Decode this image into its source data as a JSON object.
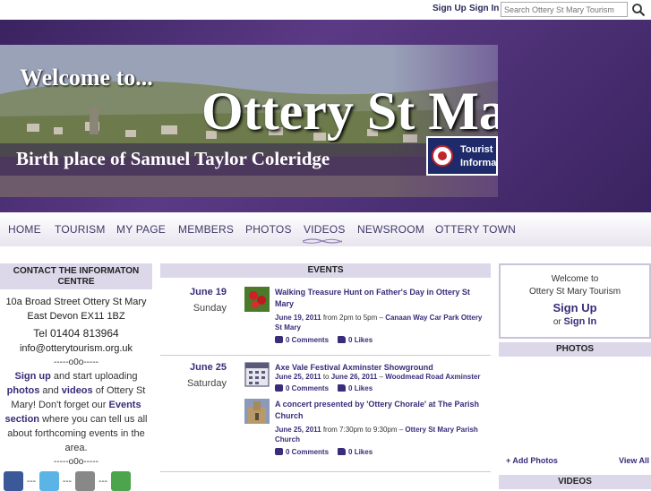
{
  "topbar": {
    "sign_up": "Sign Up",
    "sign_in": "Sign In",
    "search_placeholder": "Search Ottery St Mary Tourism"
  },
  "banner": {
    "welcome": "Welcome to...",
    "town": "Ottery St Ma",
    "birthplace": "Birth place of Samuel Taylor Coleridge",
    "tic_line1": "Tourist",
    "tic_line2": "Informa"
  },
  "nav": {
    "items": [
      "HOME",
      "TOURISM",
      "MY PAGE",
      "MEMBERS",
      "PHOTOS",
      "VIDEOS",
      "NEWSROOM",
      "OTTERY TOWN"
    ]
  },
  "contact": {
    "header": "CONTACT THE INFORMATON CENTRE",
    "address1": "10a Broad Street Ottery St Mary",
    "address2": "East Devon EX11 1BZ",
    "tel": "Tel 01404 813964",
    "email": "info@otterytourism.org.uk",
    "sep": "-----o0o-----",
    "promo_signup": "Sign up",
    "promo_text1": " and start uploading ",
    "promo_photos": "photos",
    "promo_and": " and ",
    "promo_videos": "videos",
    "promo_text2": " of Ottery St Mary! Don't forget our ",
    "promo_events": "Events section",
    "promo_text3": " where you can tell us all about forthcoming events in the area.",
    "sep2": "-----o0o-----",
    "social_dash": "---"
  },
  "events": {
    "header": "EVENTS",
    "days": [
      {
        "date": "June 19",
        "dow": "Sunday",
        "items": [
          {
            "title": "Walking Treasure Hunt on Father's Day in Ottery St Mary",
            "when_date": "June 19, 2011",
            "when_rest": " from 2pm to 5pm – ",
            "where": "Canaan Way Car Park Ottery St Mary",
            "comments": "0 Comments",
            "likes": "0 Likes",
            "thumb": "flower-thumbnail"
          }
        ]
      },
      {
        "date": "June 25",
        "dow": "Saturday",
        "items": [
          {
            "title": "Axe Vale Festival Axminster Showground",
            "when_date": "June 25, 2011",
            "when_to": " to ",
            "when_date2": "June 26, 2011",
            "when_rest": " – ",
            "where": "Woodmead Road Axminster",
            "comments": "0 Comments",
            "likes": "0 Likes",
            "thumb": "calendar-thumbnail"
          },
          {
            "title": "A concert presented by 'Ottery Chorale' at The Parish Church",
            "when_date": "June 25, 2011",
            "when_rest": " from 7:30pm to 9:30pm – ",
            "where": "Ottery St Mary Parish Church",
            "comments": "0 Comments",
            "likes": "0 Likes",
            "thumb": "church-thumbnail"
          }
        ]
      }
    ]
  },
  "sidebar_right": {
    "welcome_to": "Welcome to",
    "site_name": "Ottery St Mary Tourism",
    "sign_up": "Sign Up",
    "or": "or",
    "sign_in": "Sign In",
    "photos_header": "PHOTOS",
    "add_photos": "+ Add Photos",
    "view_all": "View All",
    "videos_header": "VIDEOS"
  },
  "colors": {
    "banner_purple": "#4b2f73",
    "accent": "#3a2c7a",
    "header_bg": "#dcd8ea"
  }
}
